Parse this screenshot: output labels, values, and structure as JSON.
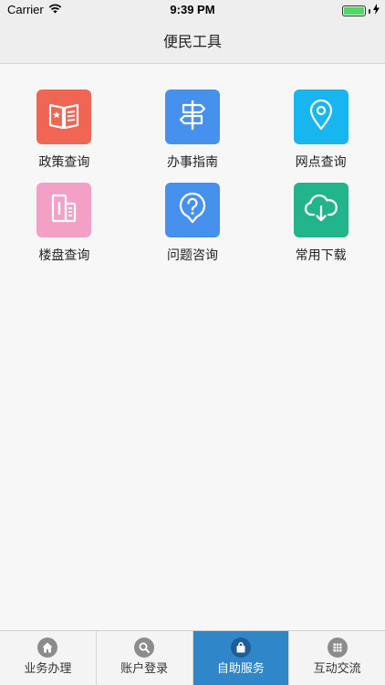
{
  "status_bar": {
    "carrier": "Carrier",
    "time": "9:39 PM",
    "battery_level": 1.0
  },
  "nav": {
    "title": "便民工具"
  },
  "tiles": [
    {
      "label": "政策查询",
      "icon": "policy-book-icon",
      "color": "#f06553"
    },
    {
      "label": "办事指南",
      "icon": "signpost-icon",
      "color": "#4690ee"
    },
    {
      "label": "网点查询",
      "icon": "location-pin-icon",
      "color": "#17b6ee"
    },
    {
      "label": "楼盘查询",
      "icon": "building-icon",
      "color": "#f3a0c7"
    },
    {
      "label": "问题咨询",
      "icon": "question-bubble-icon",
      "color": "#4690ee"
    },
    {
      "label": "常用下载",
      "icon": "cloud-download-icon",
      "color": "#22b48b"
    }
  ],
  "tab_bar": {
    "active_index": 2,
    "active_color": "#2f86c8",
    "tabs": [
      {
        "label": "业务办理",
        "icon": "home-icon"
      },
      {
        "label": "账户登录",
        "icon": "search-icon"
      },
      {
        "label": "自助服务",
        "icon": "bag-icon"
      },
      {
        "label": "互动交流",
        "icon": "grid-icon"
      }
    ]
  }
}
